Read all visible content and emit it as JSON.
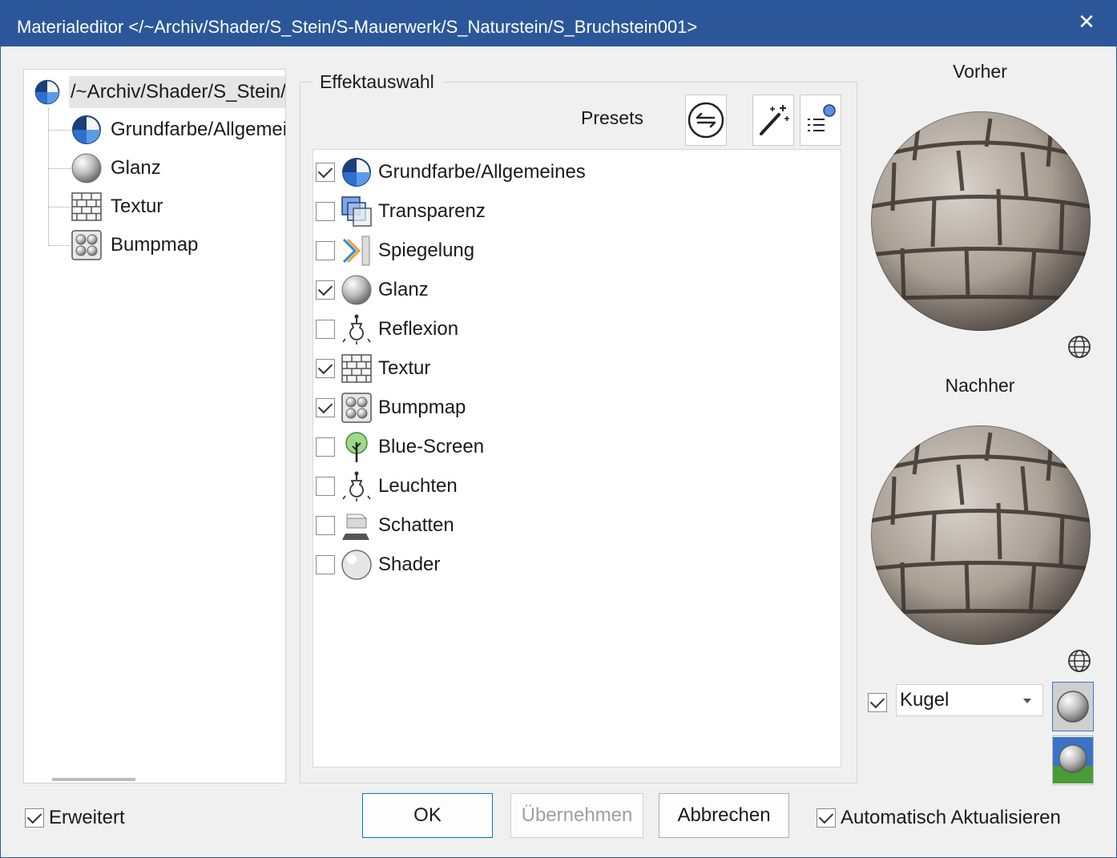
{
  "window": {
    "title": "Materialeditor    </~Archiv/Shader/S_Stein/S-Mauerwerk/S_Naturstein/S_Bruchstein001>",
    "close_glyph": "✕"
  },
  "tree": {
    "root": {
      "label": "/~Archiv/Shader/S_Stein/",
      "icon": "pie-icon"
    },
    "children": [
      {
        "label": "Grundfarbe/Allgemeines",
        "icon": "pie-icon"
      },
      {
        "label": "Glanz",
        "icon": "sphere-icon"
      },
      {
        "label": "Textur",
        "icon": "brick-icon"
      },
      {
        "label": "Bumpmap",
        "icon": "bumpmap-icon"
      }
    ]
  },
  "effects": {
    "legend": "Effektauswahl",
    "presets_label": "Presets",
    "items": [
      {
        "label": "Grundfarbe/Allgemeines",
        "checked": true,
        "icon": "pie-icon"
      },
      {
        "label": "Transparenz",
        "checked": false,
        "icon": "transparency-cubes-icon"
      },
      {
        "label": "Spiegelung",
        "checked": false,
        "icon": "mirror-icon"
      },
      {
        "label": "Glanz",
        "checked": true,
        "icon": "sphere-icon"
      },
      {
        "label": "Reflexion",
        "checked": false,
        "icon": "lightbulb-icon"
      },
      {
        "label": "Textur",
        "checked": true,
        "icon": "brick-icon"
      },
      {
        "label": "Bumpmap",
        "checked": true,
        "icon": "bumpmap-icon"
      },
      {
        "label": "Blue-Screen",
        "checked": false,
        "icon": "tree-icon"
      },
      {
        "label": "Leuchten",
        "checked": false,
        "icon": "lightbulb-icon"
      },
      {
        "label": "Schatten",
        "checked": false,
        "icon": "shadow-icon"
      },
      {
        "label": "Shader",
        "checked": false,
        "icon": "shader-sphere-icon"
      }
    ]
  },
  "preview": {
    "before_label": "Vorher",
    "after_label": "Nachher",
    "shape_checked": true,
    "shape_value": "Kugel"
  },
  "footer": {
    "extended_label": "Erweitert",
    "extended_checked": true,
    "ok_label": "OK",
    "apply_label": "Übernehmen",
    "cancel_label": "Abbrechen",
    "auto_update_label": "Automatisch Aktualisieren",
    "auto_update_checked": true
  },
  "colors": {
    "titlebar": "#2b579a",
    "accent_blue": "#1f5fbf",
    "window_bg": "#f0f0f0"
  }
}
